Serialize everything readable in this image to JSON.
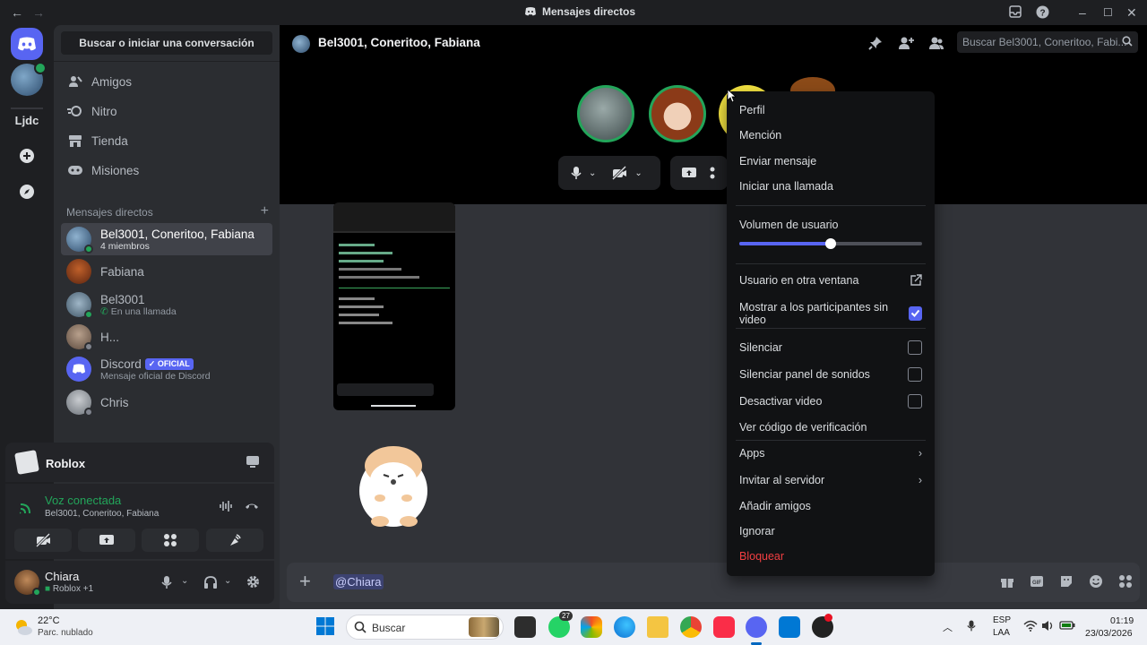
{
  "window": {
    "title": "Mensajes directos"
  },
  "rail": {
    "server_label": "Ljdc"
  },
  "sidebar": {
    "search_label": "Buscar o iniciar una conversación",
    "nav": [
      {
        "label": "Amigos",
        "icon": "friends-icon"
      },
      {
        "label": "Nitro",
        "icon": "nitro-icon"
      },
      {
        "label": "Tienda",
        "icon": "shop-icon"
      },
      {
        "label": "Misiones",
        "icon": "quests-icon"
      }
    ],
    "dm_header": "Mensajes directos",
    "dms": [
      {
        "name": "Bel3001, Coneritoo, Fabiana",
        "sub": "4 miembros"
      },
      {
        "name": "Fabiana",
        "sub": ""
      },
      {
        "name": "Bel3001",
        "sub": "En una llamada"
      },
      {
        "name": "H...",
        "sub": ""
      },
      {
        "name": "Discord",
        "badge": "OFICIAL",
        "sub": "Mensaje oficial de Discord"
      },
      {
        "name": "Chris",
        "sub": ""
      }
    ]
  },
  "game": {
    "name": "Roblox"
  },
  "voice": {
    "status": "Voz conectada",
    "channel": "Bel3001, Coneritoo, Fabiana"
  },
  "user": {
    "name": "Chiara",
    "activity": "Roblox +1"
  },
  "main": {
    "header_title": "Bel3001, Coneritoo, Fabiana",
    "search_placeholder": "Buscar Bel3001, Coneritoo, Fabi...",
    "composer_mention": "@Chiara"
  },
  "context_menu": {
    "items": {
      "perfil": "Perfil",
      "mencion": "Mención",
      "enviar": "Enviar mensaje",
      "llamada": "Iniciar una llamada",
      "volumen": "Volumen de usuario",
      "otra_ventana": "Usuario en otra ventana",
      "mostrar": "Mostrar a los participantes sin video",
      "silenciar": "Silenciar",
      "silenciar_sonidos": "Silenciar panel de sonidos",
      "desactivar_video": "Desactivar video",
      "verificacion": "Ver código de verificación",
      "apps": "Apps",
      "invitar": "Invitar al servidor",
      "anadir": "Añadir amigos",
      "ignorar": "Ignorar",
      "bloquear": "Bloquear"
    },
    "volume_fraction": 0.5,
    "checks": {
      "mostrar": true,
      "silenciar": false,
      "silenciar_sonidos": false,
      "desactivar_video": false
    },
    "danger_color": "#f23f42"
  },
  "taskbar": {
    "weather_temp": "22°C",
    "weather_desc": "Parc. nublado",
    "search_label": "Buscar",
    "whatsapp_badge": "27",
    "lang_top": "ESP",
    "lang_bottom": "LAA",
    "time": "01:19",
    "date": "23/03/2026"
  },
  "colors": {
    "accent": "#5865f2",
    "online": "#23a55a"
  }
}
